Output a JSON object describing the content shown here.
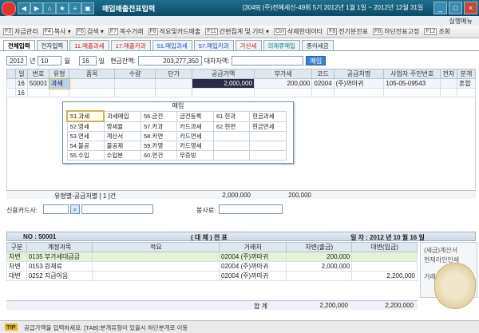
{
  "titlebar": {
    "title": "매입매출전표입력",
    "company": "[3049] (주)전혜세신-49회 5기 2012년 1월 1일 ~ 2012년 12월 31일"
  },
  "help_link": "실행메뉴",
  "toolbar": {
    "row1": [
      {
        "key": "F3",
        "label": "자금관리"
      },
      {
        "key": "F4",
        "label": "복사 ▾"
      },
      {
        "key": "F6",
        "label": "검색 ▾"
      },
      {
        "key": "F7",
        "label": "복수거래"
      },
      {
        "key": "F8",
        "label": "적요및카드매출"
      },
      {
        "key": "F11",
        "label": "간편집계 및 기타 ▾"
      },
      {
        "key": "Ctrl",
        "label": "삭제한데이타"
      },
      {
        "key": "F8",
        "label": "전기분전표"
      },
      {
        "key": "F8",
        "label": "하단전표고정"
      },
      {
        "key": "F12",
        "label": "조회"
      }
    ]
  },
  "tabs": [
    {
      "label": "전체입력",
      "style": "active"
    },
    {
      "label": "전자입력",
      "style": ""
    },
    {
      "label": "11.매출과세",
      "style": "red"
    },
    {
      "label": "17.매출카과",
      "style": "red"
    },
    {
      "label": "51.매입과세",
      "style": "blue"
    },
    {
      "label": "57.매입카과",
      "style": "blue"
    },
    {
      "label": "가산세",
      "style": "red"
    },
    {
      "label": "의제류매입",
      "style": "teal"
    },
    {
      "label": "종이세금",
      "style": ""
    }
  ],
  "header": {
    "year": "2012",
    "year_unit": "년",
    "month": "10",
    "month_unit": "월",
    "day": "16",
    "day_unit": "일",
    "cash_label": "현금잔액:",
    "cash_value": "203,277,350",
    "balance_label": "대차차액:",
    "purchase_btn": "매입"
  },
  "grid": {
    "columns": [
      "일",
      "번호",
      "유형",
      "품목",
      "수량",
      "단가",
      "공급가액",
      "부가세",
      "코드",
      "공급처명",
      "사업자·주민번호",
      "전자",
      "분개"
    ],
    "rows": [
      {
        "day": "16",
        "no": "50001",
        "type": "과세",
        "item": "",
        "qty": "",
        "price": "",
        "supply": "2,000,000",
        "vat": "200,000",
        "code": "02004",
        "vendor": "(주)까마귀",
        "bizno": "105-05-09543",
        "elec": "",
        "journal": "혼합"
      },
      {
        "day": "16",
        "no": "",
        "type": "",
        "item": "",
        "qty": "",
        "price": "",
        "supply": "",
        "vat": "",
        "code": "",
        "vendor": "",
        "bizno": "",
        "elec": "",
        "journal": ""
      }
    ],
    "total_label": "유형별-공급처별 [ 1 ]건",
    "total_supply": "2,000,000",
    "total_vat": "200,000"
  },
  "popup": {
    "title": "매입",
    "rows": [
      [
        "51.과세",
        "과세매입",
        "56.금전",
        "금전등록",
        "61.현과",
        "현금과세"
      ],
      [
        "52.영세",
        "영세율",
        "57.카과",
        "카드과세",
        "62.현면",
        "현금면세"
      ],
      [
        "53.면세",
        "계산서",
        "58.카면",
        "카드면세",
        "",
        ""
      ],
      [
        "54.불공",
        "불공제",
        "59.카영",
        "카드영세",
        "",
        ""
      ],
      [
        "55.수입",
        "수입분",
        "60.면건",
        "무증빙",
        "",
        ""
      ]
    ]
  },
  "card_label": "신용카드사:",
  "memo_label": "봉사료:",
  "voucher": {
    "no_label": "NO : 50001",
    "title": "( 대 체 ) 전 표",
    "date_label": "일 자 : 2012 년 10 월 16 일",
    "columns": [
      "구분",
      "계정과목",
      "적요",
      "거래처",
      "차변(출금)",
      "대변(입금)"
    ],
    "rows": [
      {
        "div": "차변",
        "acct": "0135 부가세대급금",
        "memo": "",
        "party": "02004 (주)까마귀",
        "debit": "200,000",
        "credit": "",
        "hl": true
      },
      {
        "div": "차변",
        "acct": "0153 원재료",
        "memo": "",
        "party": "02004 (주)까마귀",
        "debit": "2,000,000",
        "credit": "",
        "hl": false
      },
      {
        "div": "대변",
        "acct": "0252 지급어음",
        "memo": "",
        "party": "02004 (주)까마귀",
        "debit": "",
        "credit": "2,200,000",
        "hl": false
      }
    ],
    "sum_label": "합 계",
    "sum_debit": "2,200,000",
    "sum_credit": "2,200,000"
  },
  "side_panel": {
    "line1": "(세금)계산서",
    "line2": "현재라인인쇄",
    "line3": "거래명세서"
  },
  "status": {
    "tip_label": "TIP",
    "message": "공급가액을 입력하세요. [TAB]:분개유형이 있을시 하단분개로 이동"
  }
}
